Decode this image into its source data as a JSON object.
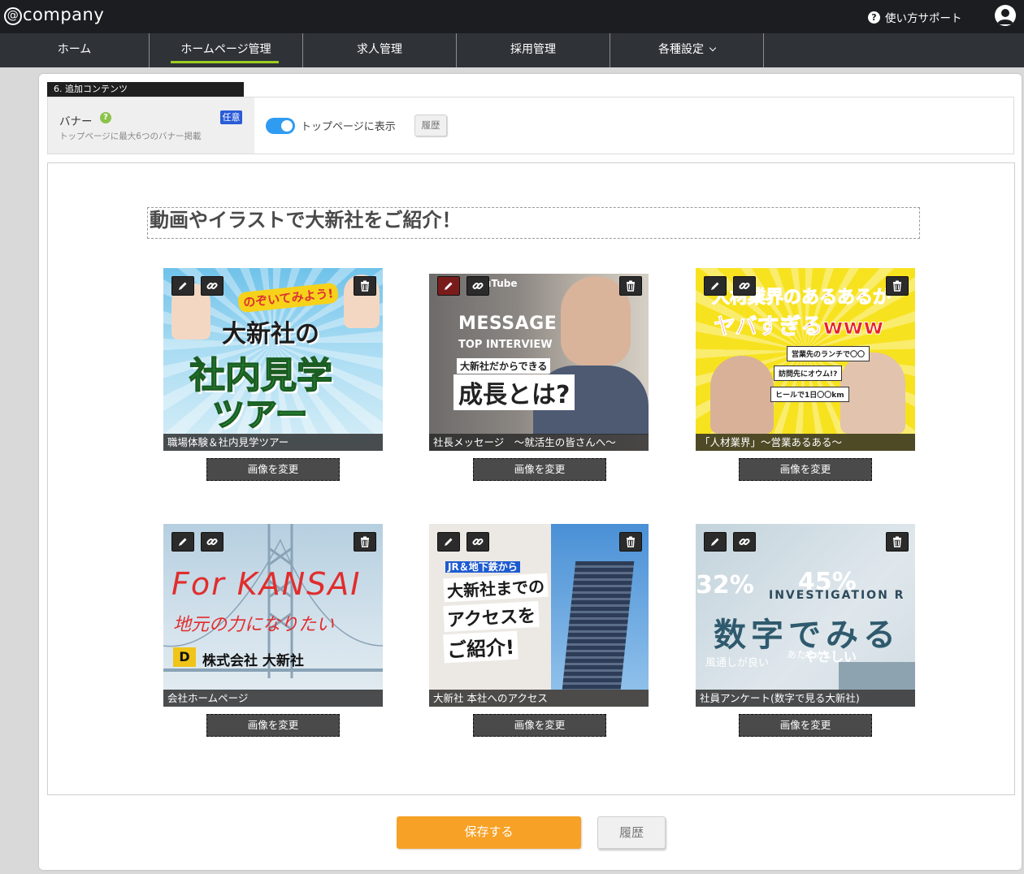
{
  "header": {
    "logo": "company",
    "support_label": "使い方サポート"
  },
  "nav": {
    "items": [
      {
        "label": "ホーム"
      },
      {
        "label": "ホームページ管理"
      },
      {
        "label": "求人管理"
      },
      {
        "label": "採用管理"
      },
      {
        "label": "各種設定"
      }
    ]
  },
  "section": {
    "tag": "6. 追加コンテンツ",
    "banner_label": "バナー",
    "banner_desc": "トップページに最大6つのバナー掲載",
    "badge": "任意",
    "toggle_label": "トップページに表示",
    "history_label": "履歴"
  },
  "content": {
    "heading": "動画やイラストで大新社をご紹介！",
    "change_label": "画像を変更",
    "cards": [
      {
        "caption": "職場体験＆社内見学ツアー",
        "art": [
          "のぞいてみよう!",
          "大新社の",
          "社内見学",
          "ツアー"
        ]
      },
      {
        "caption": "社長メッセージ　～就活生の皆さんへ～",
        "art": [
          "YouTube",
          "MESSAGE",
          "TOP INTERVIEW",
          "大新社だからできる",
          "成長とは?"
        ]
      },
      {
        "caption": "「人材業界」～営業あるある～",
        "art": [
          "人材業界のあるあるが",
          "ヤバすぎるwww",
          "営業先のランチで〇〇",
          "訪問先にオウム!?",
          "ヒールで1日〇〇km"
        ]
      },
      {
        "caption": "会社ホームページ",
        "art": [
          "For KANSAI",
          "地元の力になりたい",
          "株式会社 大新社"
        ]
      },
      {
        "caption": "大新社 本社へのアクセス",
        "art": [
          "JR＆地下鉄から",
          "大新社までの",
          "アクセスを",
          "ご紹介!"
        ]
      },
      {
        "caption": "社員アンケート(数字で見る大新社)",
        "art": [
          "32%",
          "45%",
          "INVESTIGATION R",
          "数字でみる",
          "風通しが良い",
          "やさしい",
          "あたたかい"
        ]
      }
    ]
  },
  "footer": {
    "save_label": "保存する",
    "history_label": "履歴"
  },
  "colors": {
    "accent_green": "#9ccc1e",
    "save_orange": "#f7a126",
    "toggle_blue": "#2f9cf2",
    "badge_blue": "#2a5bd7"
  }
}
